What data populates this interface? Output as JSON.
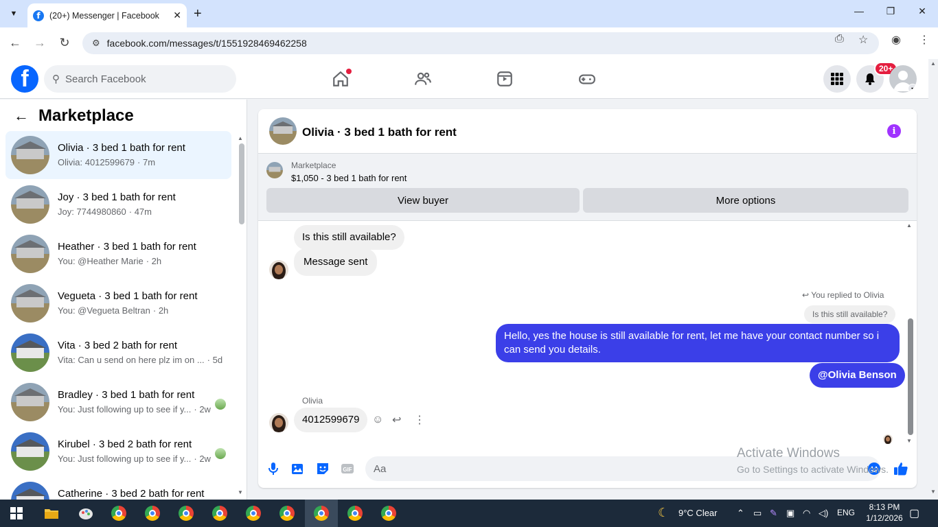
{
  "browser": {
    "tab_title": "(20+) Messenger | Facebook",
    "url": "facebook.com/messages/t/1551928469462258"
  },
  "fb": {
    "search_placeholder": "Search Facebook",
    "notif_badge": "20+"
  },
  "sidebar": {
    "title": "Marketplace",
    "conversations": [
      {
        "name": "Olivia · 3 bed 1 bath for rent",
        "preview": "Olivia: 4012599679",
        "time": "· 7m",
        "active": true
      },
      {
        "name": "Joy · 3 bed 1 bath for rent",
        "preview": "Joy: 7744980860",
        "time": "· 47m"
      },
      {
        "name": "Heather · 3 bed 1 bath for rent",
        "preview": "You: @Heather Marie",
        "time": "· 2h"
      },
      {
        "name": "Vegueta · 3 bed 1 bath for rent",
        "preview": "You: @Vegueta Beltran",
        "time": "· 2h"
      },
      {
        "name": "Vita · 3 bed 2 bath for rent",
        "preview": "Vita: Can u send on here plz im on ...",
        "time": "· 5d"
      },
      {
        "name": "Bradley · 3 bed 1 bath for rent",
        "preview": "You: Just following up to see if y...",
        "time": "· 2w"
      },
      {
        "name": "Kirubel · 3 bed 2 bath for rent",
        "preview": "You: Just following up to see if y...",
        "time": "· 2w"
      },
      {
        "name": "Catherine · 3 bed 2 bath for rent",
        "preview": "",
        "time": ""
      }
    ]
  },
  "chat": {
    "title": "Olivia · 3 bed 1 bath for rent",
    "marketplace_label": "Marketplace",
    "listing": "$1,050 - 3 bed 1 bath for rent",
    "view_buyer": "View buyer",
    "more_options": "More options",
    "msg1": "Is this still available?",
    "msg2": "Message sent",
    "replied_to": "You replied to Olivia",
    "quoted": "Is this still available?",
    "reply_text": "Hello, yes the house is still available for rent, let me have your contact number so i can send you details.",
    "mention": "@Olivia Benson",
    "sender_name": "Olivia",
    "number_msg": "4012599679",
    "composer_placeholder": "Aa"
  },
  "watermark": {
    "line1": "Activate Windows",
    "line2": "Go to Settings to activate Windows."
  },
  "taskbar": {
    "weather": "9°C  Clear",
    "lang": "ENG",
    "time": "8:13 PM",
    "date": "1/12/2026"
  },
  "colors": {
    "fb_blue": "#0866ff",
    "outgoing_bubble": "#3b3fe8",
    "active_row": "#ebf5ff"
  }
}
